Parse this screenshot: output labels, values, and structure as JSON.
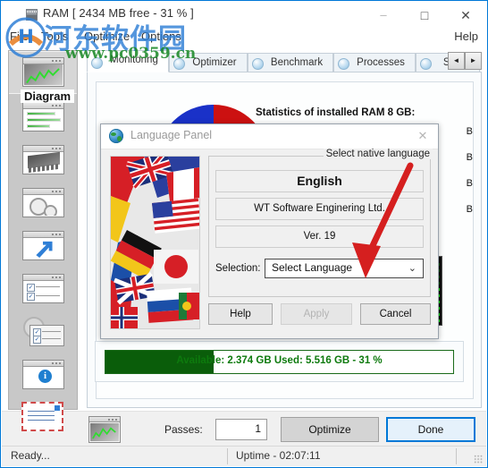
{
  "window": {
    "title": "RAM [ 2434 MB free - 31 % ]",
    "icon": "ram-chip-icon",
    "minimize": "–",
    "maximize": "□",
    "close": "✕"
  },
  "menu": {
    "items": [
      "File",
      "Tools",
      "Optimize",
      "Options"
    ],
    "help": "Help"
  },
  "watermark": {
    "chinese": "河东软件园",
    "url": "www.pc0359.cn"
  },
  "sidebar": {
    "items": [
      {
        "name": "monitoring",
        "icon": "chart-window-icon"
      },
      {
        "name": "memory-bars",
        "icon": "bars-window-icon"
      },
      {
        "name": "hardware",
        "icon": "chip-window-icon"
      },
      {
        "name": "settings",
        "icon": "gears-window-icon"
      },
      {
        "name": "shortcuts",
        "icon": "arrow-window-icon"
      },
      {
        "name": "tasks",
        "icon": "checklist-window-icon"
      },
      {
        "name": "auto-tasks",
        "icon": "gear-checklist-icon"
      },
      {
        "name": "about",
        "icon": "info-window-icon"
      },
      {
        "name": "contact",
        "icon": "envelope-icon"
      }
    ]
  },
  "tabs": {
    "items": [
      "Monitoring",
      "Optimizer",
      "Benchmark",
      "Processes",
      "Shor"
    ],
    "active_index": 0,
    "scroll_left": "◄",
    "scroll_right": "►"
  },
  "main": {
    "diagram_title": "Diagram",
    "stats_title": "Statistics of installed RAM 8 GB:",
    "stat_rows": [
      "B",
      "B",
      "B",
      "B"
    ],
    "memory_bar": "Available: 2.374 GB  Used: 5.516 GB - 31 %",
    "memory_used_percent": 31
  },
  "actionbar": {
    "icon": "chart-window-icon",
    "passes_label": "Passes:",
    "passes_value": "1",
    "optimize_label": "Optimize",
    "done_label": "Done"
  },
  "statusbar": {
    "ready": "Ready...",
    "uptime": "Uptime - 02:07:11"
  },
  "dialog": {
    "icon": "globe-icon",
    "title": "Language Panel",
    "close": "✕",
    "flags_image": "world-flags-collage",
    "hint": "Select native language",
    "language": "English",
    "company": "WT Software Enginering Ltd.",
    "version": "Ver. 19",
    "selection_label": "Selection:",
    "combo_value": "Select Language",
    "combo_chevron": "⌄",
    "buttons": {
      "help": "Help",
      "apply": "Apply",
      "cancel": "Cancel"
    }
  },
  "annotation": {
    "arrow_color": "#d51f1f"
  },
  "colors": {
    "accent": "#0078d7",
    "green_bar": "#0a5d0a",
    "dome_left": "#1a31c8",
    "dome_right": "#cc1111"
  }
}
